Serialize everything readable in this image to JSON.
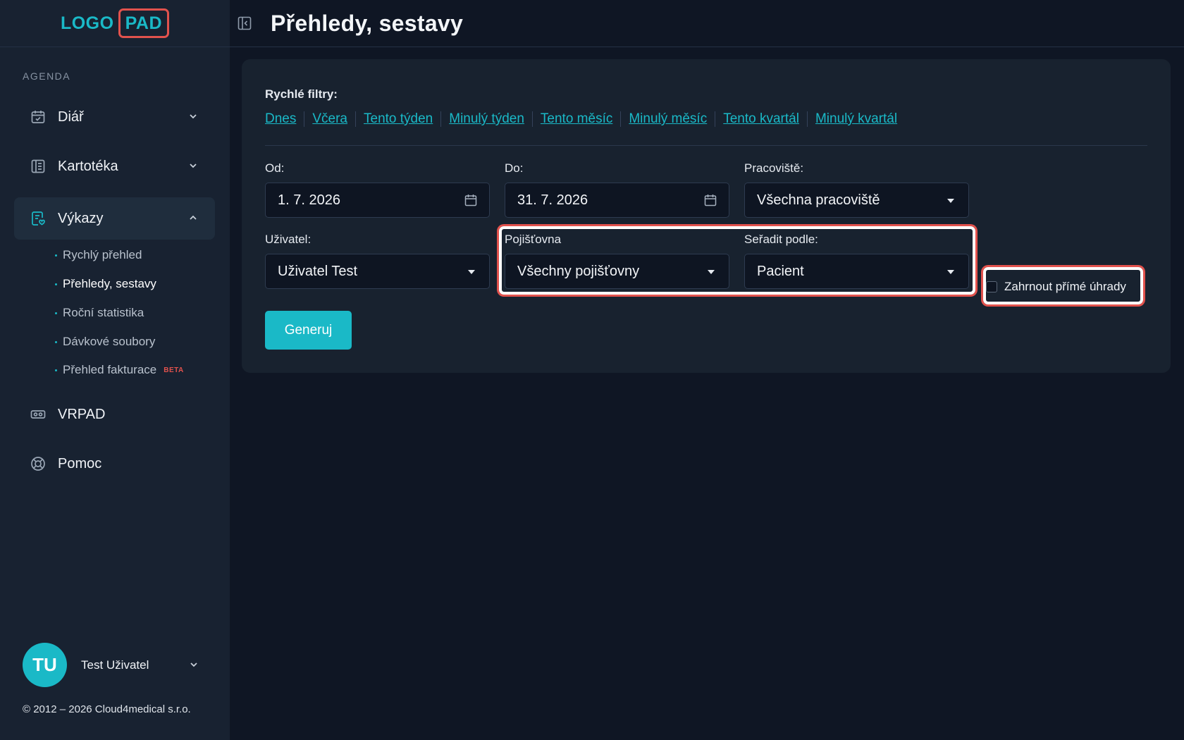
{
  "app": {
    "logo_left": "LOGO",
    "logo_right": "PAD"
  },
  "sidebar": {
    "section_label": "AGENDA",
    "items": [
      {
        "label": "Diář",
        "icon": "calendar-check-icon"
      },
      {
        "label": "Kartotéka",
        "icon": "card-file-icon"
      },
      {
        "label": "Výkazy",
        "icon": "report-icon",
        "active": true
      },
      {
        "label": "VRPAD",
        "icon": "vr-headset-icon"
      },
      {
        "label": "Pomoc",
        "icon": "lifebuoy-icon"
      }
    ],
    "vykazy_sub": [
      {
        "label": "Rychlý přehled"
      },
      {
        "label": "Přehledy, sestavy",
        "current": true
      },
      {
        "label": "Roční statistika"
      },
      {
        "label": "Dávkové soubory"
      },
      {
        "label": "Přehled fakturace",
        "badge": "BETA"
      }
    ],
    "user": {
      "initials": "TU",
      "name": "Test Uživatel"
    },
    "copyright": "© 2012 – 2026 Cloud4medical s.r.o."
  },
  "header": {
    "title": "Přehledy, sestavy"
  },
  "filters": {
    "quick_label": "Rychlé filtry:",
    "quick": [
      "Dnes",
      "Včera",
      "Tento týden",
      "Minulý týden",
      "Tento měsíc",
      "Minulý měsíc",
      "Tento kvartál",
      "Minulý kvartál"
    ],
    "od_label": "Od:",
    "od_value": "1. 7. 2026",
    "do_label": "Do:",
    "do_value": "31. 7. 2026",
    "pracoviste_label": "Pracoviště:",
    "pracoviste_value": "Všechna pracoviště",
    "uzivatel_label": "Uživatel:",
    "uzivatel_value": "Uživatel Test",
    "pojistovna_label": "Pojišťovna",
    "pojistovna_value": "Všechny pojišťovny",
    "seradit_label": "Seřadit podle:",
    "seradit_value": "Pacient",
    "checkbox_label": "Zahrnout přímé úhrady",
    "generate_label": "Generuj"
  },
  "colors": {
    "accent": "#1ab9c7",
    "highlight": "#e2524d",
    "background": "#0f1624",
    "sidebar": "#182231"
  }
}
